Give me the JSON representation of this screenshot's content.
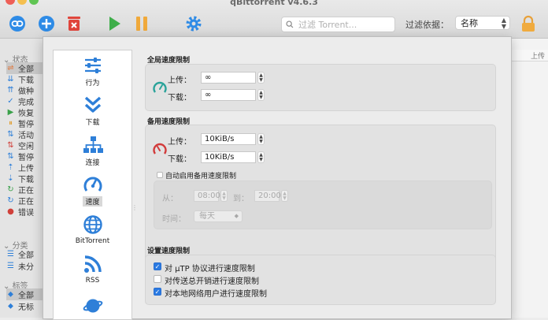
{
  "app": {
    "title": "qBittorrent v4.6.3"
  },
  "toolbar": {
    "search_placeholder": "过滤 Torrent...",
    "filter_label": "过滤依据：",
    "filter_value": "名称"
  },
  "sidebar": {
    "status_header": "状态",
    "status_items": [
      {
        "label": "全部",
        "color": "#e0763a"
      },
      {
        "label": "下载",
        "color": "#2e7fd8"
      },
      {
        "label": "做种",
        "color": "#2e7fd8"
      },
      {
        "label": "完成",
        "color": "#2e7fd8"
      },
      {
        "label": "恢复",
        "color": "#3aa14a"
      },
      {
        "label": "暂停",
        "color": "#e0a23a"
      },
      {
        "label": "活动",
        "color": "#2e7fd8"
      },
      {
        "label": "空闲",
        "color": "#d0403a"
      },
      {
        "label": "暂停",
        "color": "#2e7fd8"
      },
      {
        "label": "上传",
        "color": "#2e7fd8"
      },
      {
        "label": "下载",
        "color": "#2e7fd8"
      },
      {
        "label": "正在",
        "color": "#3aa14a"
      },
      {
        "label": "正在",
        "color": "#2e7fd8"
      },
      {
        "label": "错误",
        "color": "#d0403a"
      }
    ],
    "category_header": "分类",
    "category_items": [
      {
        "label": "全部"
      },
      {
        "label": "未分"
      }
    ],
    "tag_header": "标签",
    "tag_items": [
      {
        "label": "全部"
      },
      {
        "label": "无标"
      }
    ]
  },
  "list": {
    "col_header": "上传"
  },
  "prefs": {
    "categories": [
      {
        "label": "行为",
        "icon": "sliders-icon"
      },
      {
        "label": "下载",
        "icon": "double-chevron-down-icon"
      },
      {
        "label": "连接",
        "icon": "network-icon"
      },
      {
        "label": "速度",
        "icon": "speedometer-icon",
        "selected": true
      },
      {
        "label": "BitTorrent",
        "icon": "globe-icon"
      },
      {
        "label": "RSS",
        "icon": "rss-icon"
      },
      {
        "label": "",
        "icon": "planet-icon"
      }
    ],
    "global": {
      "title": "全局速度限制",
      "upload_label": "上传：",
      "upload_value": "∞",
      "download_label": "下载：",
      "download_value": "∞"
    },
    "alt": {
      "title": "备用速度限制",
      "upload_label": "上传：",
      "upload_value": "10KiB/s",
      "download_label": "下载：",
      "download_value": "10KiB/s"
    },
    "schedule": {
      "checkbox_label": "自动启用备用速度限制",
      "from_label": "从：",
      "from_value": "08:00",
      "to_label": "到：",
      "to_value": "20:00",
      "when_label": "时间：",
      "when_value": "每天"
    },
    "settings": {
      "title": "设置速度限制",
      "opt1": "对 µTP 协议进行速度限制",
      "opt2": "对传送总开销进行速度限制",
      "opt3": "对本地网络用户进行速度限制"
    }
  }
}
